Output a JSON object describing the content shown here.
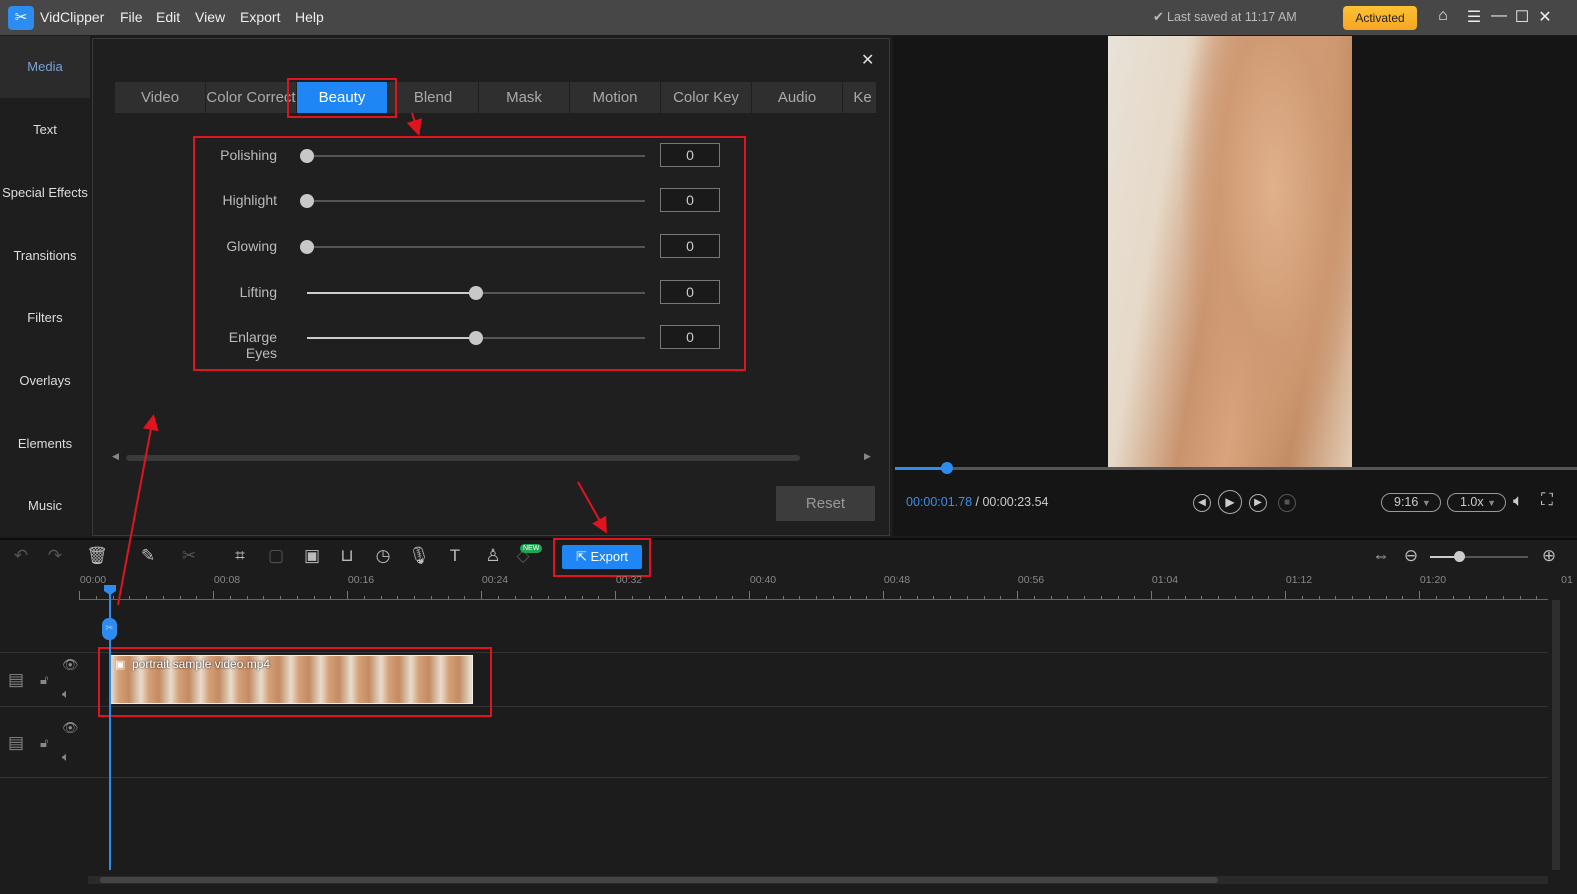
{
  "app": {
    "name": "VidClipper",
    "menu": [
      "File",
      "Edit",
      "View",
      "Export",
      "Help"
    ],
    "last_saved": "Last saved at 11:17 AM",
    "activated": "Activated"
  },
  "sidebar": {
    "items": [
      "Media",
      "Text",
      "Special Effects",
      "Transitions",
      "Filters",
      "Overlays",
      "Elements",
      "Music"
    ],
    "active": "Media"
  },
  "panel": {
    "tabs": [
      "Video",
      "Color Correct",
      "Beauty",
      "Blend",
      "Mask",
      "Motion",
      "Color Key",
      "Audio",
      "Ke"
    ],
    "active_tab": "Beauty",
    "sliders": [
      {
        "label": "Polishing",
        "value": "0",
        "level": 0
      },
      {
        "label": "Highlight",
        "value": "0",
        "level": 0
      },
      {
        "label": "Glowing",
        "value": "0",
        "level": 0
      },
      {
        "label": "Lifting",
        "value": "0",
        "level": 0.5
      },
      {
        "label": "Enlarge Eyes",
        "value": "0",
        "level": 0.5
      }
    ],
    "reset": "Reset"
  },
  "preview": {
    "current": "00:00:01.78",
    "total": "/ 00:00:23.54",
    "progress": 0.076,
    "ratio": "9:16",
    "speed": "1.0x"
  },
  "timeline": {
    "export": "Export",
    "new_badge": "NEW",
    "ruler": [
      "00:00",
      "00:08",
      "00:16",
      "00:24",
      "00:32",
      "00:40",
      "00:48",
      "00:56",
      "01:04",
      "01:12",
      "01:20",
      "01"
    ],
    "clip": "portrait sample video.mp4",
    "zoom_level": 0.3
  },
  "colors": {
    "accent": "#1e86f5",
    "annotation": "#e0141e",
    "activated": "#f5a623"
  }
}
